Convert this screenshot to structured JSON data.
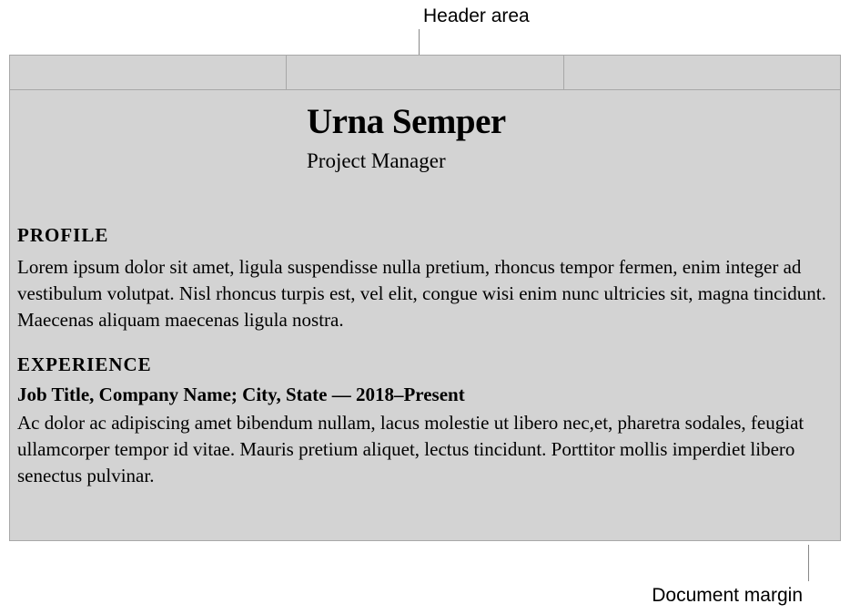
{
  "annotations": {
    "top": "Header area",
    "bottom": "Document margin"
  },
  "document": {
    "name": "Urna Semper",
    "role": "Project Manager",
    "sections": {
      "profile": {
        "heading": "PROFILE",
        "body": "Lorem ipsum dolor sit amet, ligula suspendisse nulla pretium, rhoncus tempor fermen, enim integer ad vestibulum volutpat. Nisl rhoncus turpis est, vel elit, congue wisi enim nunc ultricies sit, magna tincidunt. Maecenas aliquam maecenas ligula nostra."
      },
      "experience": {
        "heading": "EXPERIENCE",
        "job_line": "Job Title, Company Name; City, State — 2018–Present",
        "body": "Ac dolor ac adipiscing amet bibendum nullam, lacus molestie ut libero nec,et, pharetra sodales, feugiat ullamcorper tempor id vitae. Mauris pretium aliquet, lectus tincidunt. Porttitor mollis imperdiet libero senectus pulvinar."
      }
    }
  }
}
